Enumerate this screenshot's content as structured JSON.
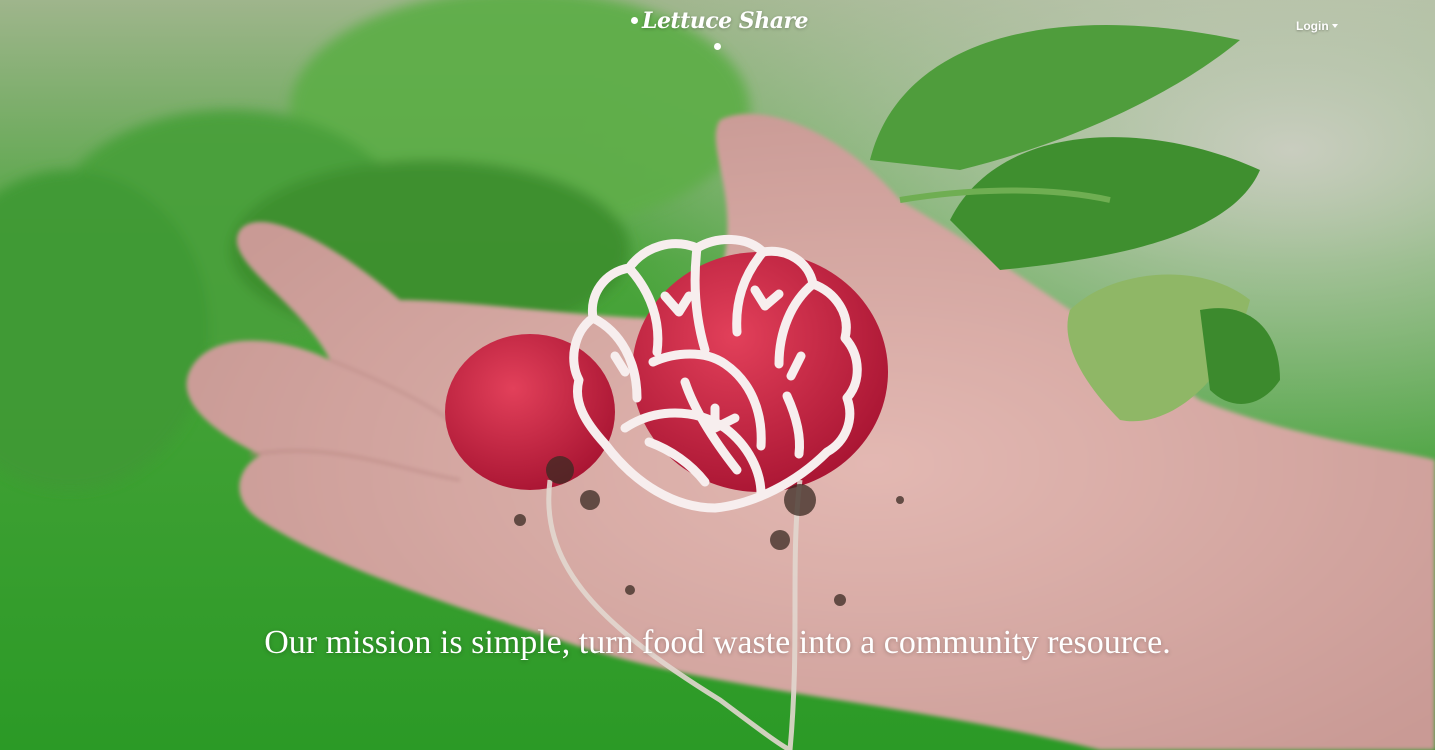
{
  "navbar": {
    "brand": "Lettuce Share",
    "login_label": "Login"
  },
  "hero": {
    "photo": "radishes-in-hand-photo",
    "logo_icon": "lettuce-icon",
    "mission": "Our mission is simple, turn food waste into a community resource."
  },
  "colors": {
    "text": "#ffffff",
    "logo_stroke": "#f7eeee",
    "background_green": "#2f9a2a",
    "radish_red": "#c8213f"
  }
}
